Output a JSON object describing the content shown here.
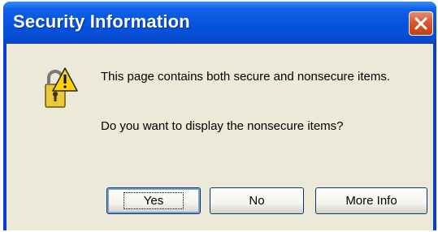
{
  "dialog": {
    "title": "Security Information",
    "message_line": "This page contains both secure and nonsecure items.",
    "question": "Do you want to display the nonsecure items?",
    "icon": "lock-warning-icon"
  },
  "buttons": {
    "yes": "Yes",
    "no": "No",
    "more_info": "More Info"
  },
  "colors": {
    "titlebar": "#0654e0",
    "client": "#ece9d8",
    "close_button": "#d4562e"
  }
}
